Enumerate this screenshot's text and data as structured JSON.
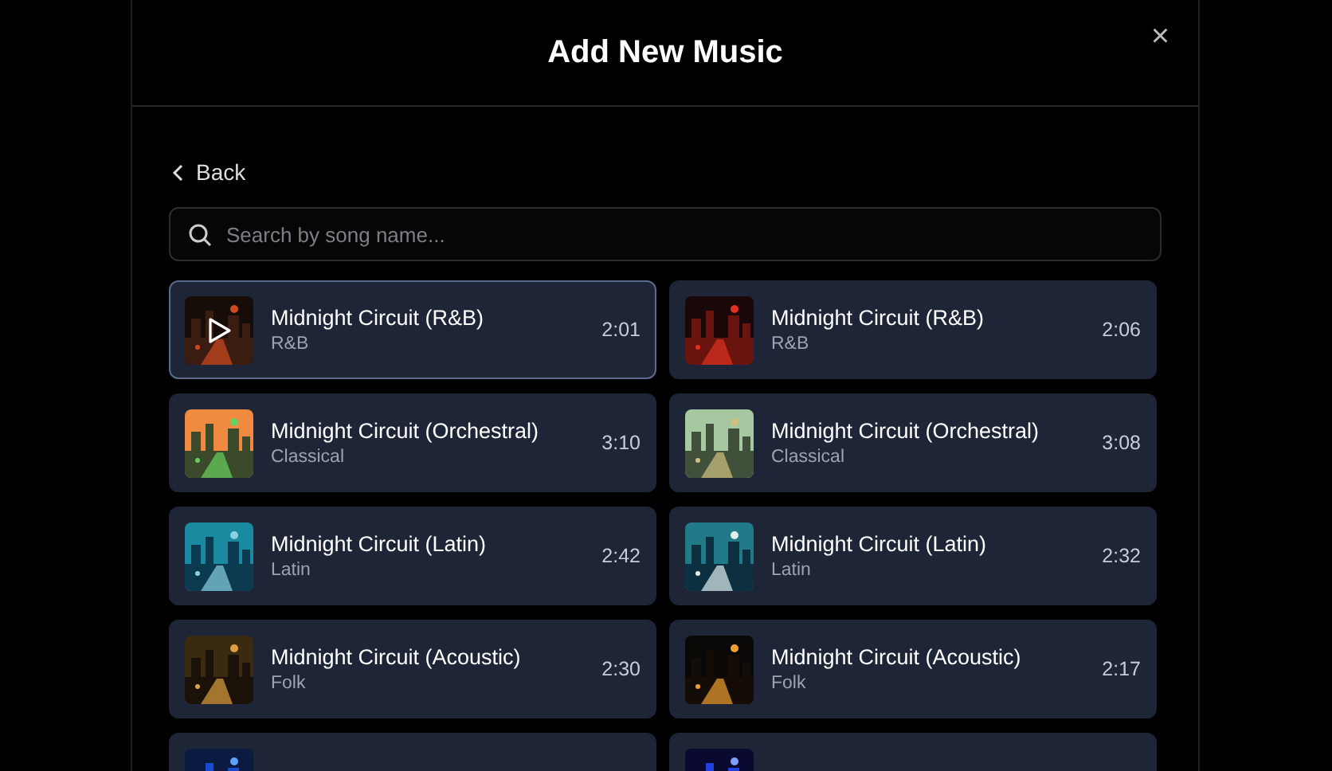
{
  "dialog": {
    "title": "Add New Music",
    "close": "×"
  },
  "back": {
    "label": "Back"
  },
  "search": {
    "placeholder": "Search by song name..."
  },
  "songs": [
    {
      "kind": "song",
      "title": "Midnight Circuit (R&B)",
      "genre": "R&B",
      "duration": "2:01",
      "selected": true
    },
    {
      "kind": "song",
      "title": "Midnight Circuit (R&B)",
      "genre": "R&B",
      "duration": "2:06",
      "selected": false
    },
    {
      "kind": "song",
      "title": "Midnight Circuit (Orchestral)",
      "genre": "Classical",
      "duration": "3:10",
      "selected": false
    },
    {
      "kind": "song",
      "title": "Midnight Circuit (Orchestral)",
      "genre": "Classical",
      "duration": "3:08",
      "selected": false
    },
    {
      "kind": "song",
      "title": "Midnight Circuit (Latin)",
      "genre": "Latin",
      "duration": "2:42",
      "selected": false
    },
    {
      "kind": "song",
      "title": "Midnight Circuit (Latin)",
      "genre": "Latin",
      "duration": "2:32",
      "selected": false
    },
    {
      "kind": "song",
      "title": "Midnight Circuit (Acoustic)",
      "genre": "Folk",
      "duration": "2:30",
      "selected": false
    },
    {
      "kind": "song",
      "title": "Midnight Circuit (Acoustic)",
      "genre": "Folk",
      "duration": "2:17",
      "selected": false
    },
    {
      "kind": "partial"
    },
    {
      "kind": "partial"
    }
  ]
}
